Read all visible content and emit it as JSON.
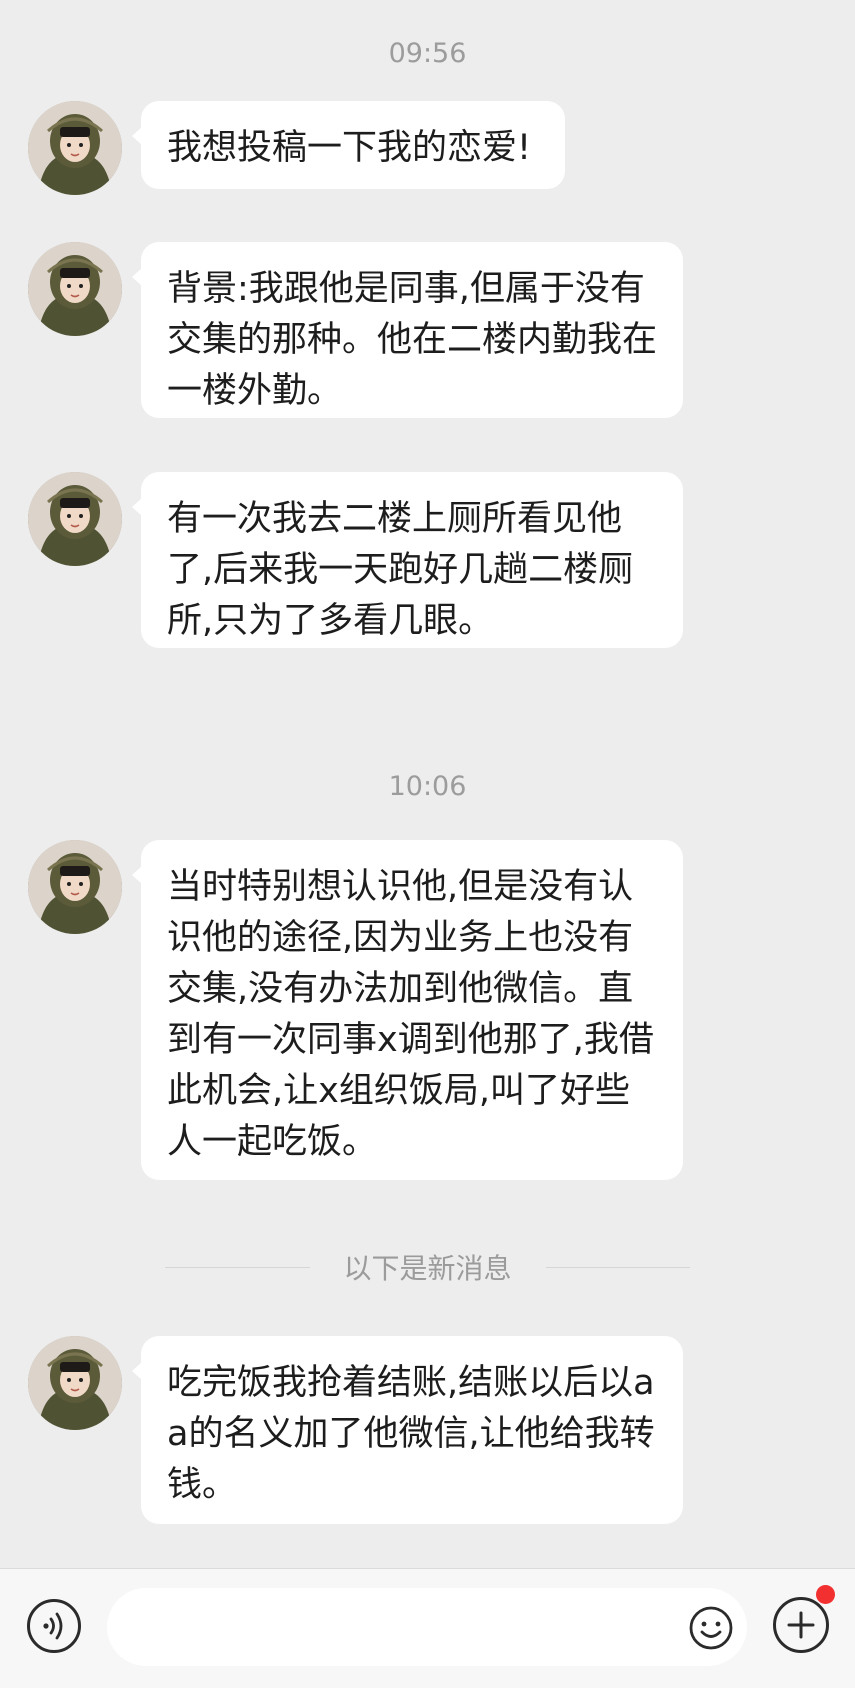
{
  "chat": {
    "timestamps": [
      "09:56",
      "10:06"
    ],
    "messages": [
      {
        "text": "我想投稿一下我的恋爱!"
      },
      {
        "text": "背景:我跟他是同事,但属于没有交集的那种。他在二楼内勤我在一楼外勤。"
      },
      {
        "text": "有一次我去二楼上厕所看见他了,后来我一天跑好几趟二楼厕所,只为了多看几眼。"
      },
      {
        "text": "当时特别想认识他,但是没有认识他的途径,因为业务上也没有交集,没有办法加到他微信。直到有一次同事x调到他那了,我借此机会,让x组织饭局,叫了好些人一起吃饭。"
      },
      {
        "text": "吃完饭我抢着结账,结账以后以aa的名义加了他微信,让他给我转钱。"
      }
    ],
    "new_messages_divider": "以下是新消息"
  },
  "input_bar": {
    "placeholder": "",
    "icons": {
      "voice": "voice-icon",
      "emoji": "emoji-icon",
      "plus": "plus-icon"
    },
    "badge_color": "#f23030"
  },
  "colors": {
    "background": "#ededed",
    "bubble": "#ffffff",
    "timestamp": "#9c9c9c"
  }
}
